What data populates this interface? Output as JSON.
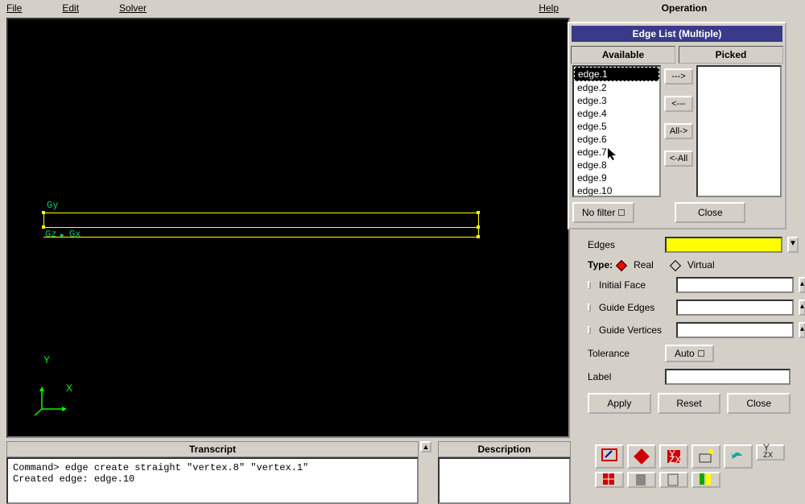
{
  "menu": {
    "file": "File",
    "edit": "Edit",
    "solver": "Solver",
    "help": "Help"
  },
  "viewport": {
    "labels": {
      "gy": "Gy",
      "gz": "Gz",
      "gx": "Gx"
    },
    "axis": {
      "x": "X",
      "y": "Y"
    }
  },
  "transcript": {
    "title": "Transcript",
    "lines": "Command> edge create straight \"vertex.8\" \"vertex.1\"\nCreated edge: edge.10"
  },
  "description": {
    "title": "Description"
  },
  "operation": {
    "title": "Operation"
  },
  "dialog": {
    "title": "Edge List (Multiple)",
    "available": "Available",
    "picked": "Picked",
    "items": [
      "edge.1",
      "edge.2",
      "edge.3",
      "edge.4",
      "edge.5",
      "edge.6",
      "edge.7",
      "edge.8",
      "edge.9",
      "edge.10"
    ],
    "btn_add": "--->",
    "btn_remove": "<---",
    "btn_all": "All->",
    "btn_none": "<-All",
    "no_filter": "No filter",
    "close": "Close"
  },
  "form": {
    "edges": "Edges",
    "type": "Type:",
    "real": "Real",
    "virtual": "Virtual",
    "initial_face": "Initial Face",
    "guide_edges": "Guide Edges",
    "guide_vertices": "Guide Vertices",
    "tolerance": "Tolerance",
    "auto": "Auto",
    "label": "Label",
    "apply": "Apply",
    "reset": "Reset",
    "close": "Close"
  }
}
